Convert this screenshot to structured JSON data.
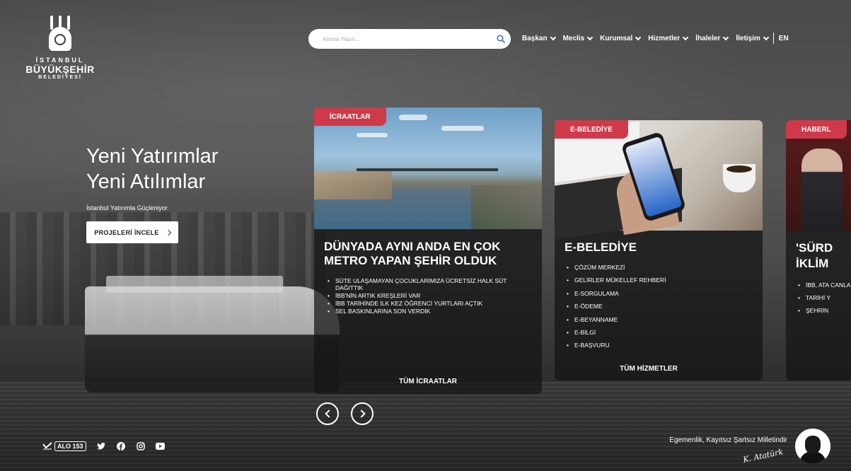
{
  "logo": {
    "line1": "İSTANBUL",
    "line2": "BÜYÜKŞEHİR",
    "line3": "BELEDİYESİ"
  },
  "search": {
    "placeholder": "Arama Yapın...",
    "icon": "search-icon"
  },
  "nav": {
    "items": [
      {
        "label": "Başkan"
      },
      {
        "label": "Meclis"
      },
      {
        "label": "Kurumsal"
      },
      {
        "label": "Hizmetler"
      },
      {
        "label": "İhaleler"
      },
      {
        "label": "İletişim"
      }
    ],
    "lang": "EN"
  },
  "hero": {
    "title_line1": "Yeni Yatırımlar",
    "title_line2": "Yeni Atılımlar",
    "subtitle": "İstanbul Yatırımla Güçleniyor",
    "button": "PROJELERİ İNCELE"
  },
  "cards": [
    {
      "tag": "İCRAATLAR",
      "title": "DÜNYADA AYNI ANDA EN ÇOK METRO YAPAN ŞEHİR OLDUK",
      "items": [
        "SÜTE ULAŞAMAYAN ÇOCUKLARIMIZA ÜCRETSİZ HALK SÜT DAĞITTIK",
        "İBB'NİN ARTIK KREŞLERİ VAR",
        "İBB TARİHİNDE İLK KEZ ÖĞRENCİ YURTLARI AÇTIK",
        "SEL BASKINLARINA SON VERDİK"
      ],
      "cta": "TÜM İCRAATLAR"
    },
    {
      "tag": "E-BELEDİYE",
      "title": "E-BELEDİYE",
      "items": [
        "ÇÖZÜM MERKEZİ",
        "GELİRLER MÜKELLEF REHBERİ",
        "E-SORGULAMA",
        "E-ÖDEME",
        "E-BEYANNAME",
        "E-BİLGİ",
        "E-BAŞVURU"
      ],
      "cta": "TÜM HİZMETLER"
    },
    {
      "tag": "HABERL",
      "title_line1": "'SÜRD",
      "title_line2": "İKLİM",
      "items": [
        "İBB, ATA CANLAI",
        "TARİHİ Y",
        "ŞEHRİN"
      ]
    }
  ],
  "footer": {
    "alo": "ALO 153",
    "social": [
      "twitter-icon",
      "facebook-icon",
      "instagram-icon",
      "youtube-icon"
    ],
    "motto": "Egemenlik, Kayıtsız Şartsız Milletindir",
    "signature": "K. Atatürk"
  },
  "colors": {
    "accent": "#cf3a4b",
    "search_icon": "#2f5fa8"
  }
}
